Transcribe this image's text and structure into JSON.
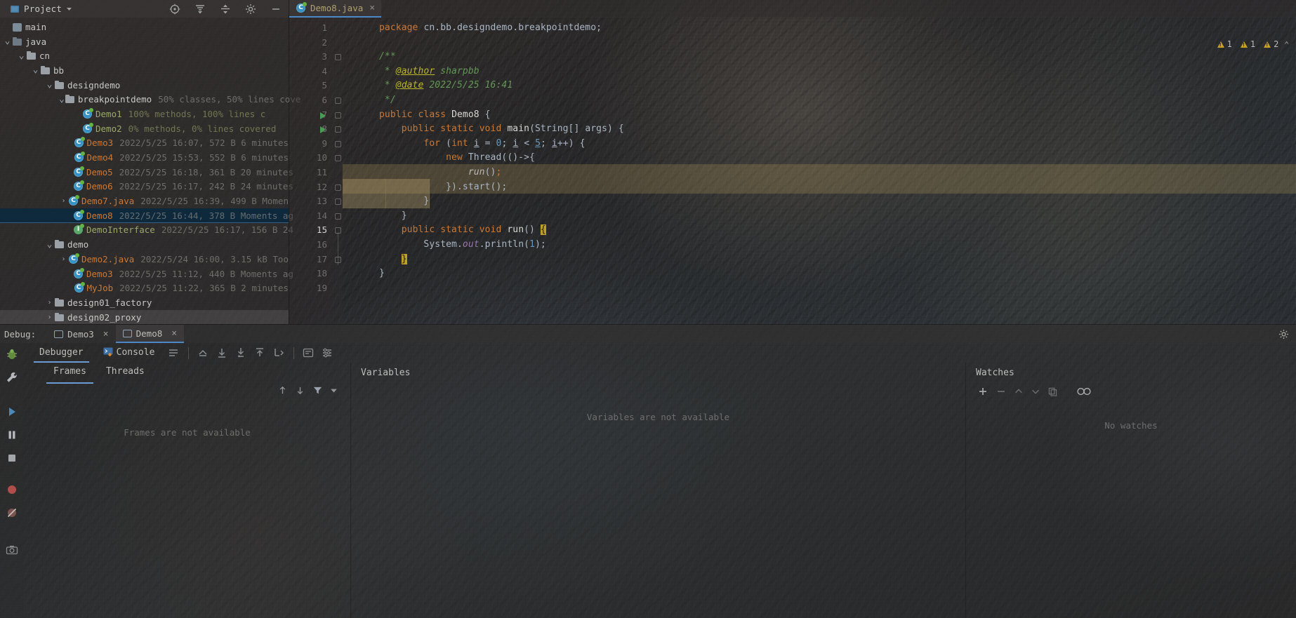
{
  "project": {
    "header_title": "Project",
    "icons": [
      "project-view-icon",
      "chevron-down-icon",
      "locate-icon",
      "expand-all-icon",
      "collapse-all-icon",
      "settings-gear-icon",
      "minimize-icon"
    ],
    "tree": [
      {
        "indent": 0,
        "arrow": "",
        "icon": "module-icon",
        "name": "main",
        "name_class": "n-white",
        "meta": ""
      },
      {
        "indent": 0,
        "arrow": "v",
        "icon": "folder-src",
        "name": "java",
        "name_class": "n-white",
        "meta": ""
      },
      {
        "indent": 1,
        "arrow": "v",
        "icon": "folder",
        "name": "cn",
        "name_class": "n-white",
        "meta": ""
      },
      {
        "indent": 2,
        "arrow": "v",
        "icon": "folder",
        "name": "bb",
        "name_class": "n-white",
        "meta": ""
      },
      {
        "indent": 3,
        "arrow": "v",
        "icon": "folder",
        "name": "designdemo",
        "name_class": "n-white",
        "meta": ""
      },
      {
        "indent": 4,
        "arrow": "v",
        "icon": "folder",
        "name": "breakpointdemo",
        "name_class": "n-white",
        "meta": "50% classes, 50% lines cove"
      },
      {
        "indent": 5,
        "arrow": "",
        "icon": "class",
        "name": "Demo1",
        "name_class": "n-green-t",
        "meta": "100% methods, 100% lines c",
        "meta_class": "meta-green"
      },
      {
        "indent": 5,
        "arrow": "",
        "icon": "class",
        "name": "Demo2",
        "name_class": "n-green-t",
        "meta": "0% methods, 0% lines covered",
        "meta_class": "meta-green"
      },
      {
        "indent": 5,
        "arrow": "",
        "icon": "class",
        "name": "Demo3",
        "name_class": "n-orange",
        "meta": "2022/5/25 16:07, 572 B 6 minutes"
      },
      {
        "indent": 5,
        "arrow": "",
        "icon": "class",
        "name": "Demo4",
        "name_class": "n-orange",
        "meta": "2022/5/25 15:53, 552 B 6 minutes"
      },
      {
        "indent": 5,
        "arrow": "",
        "icon": "class",
        "name": "Demo5",
        "name_class": "n-orange",
        "meta": "2022/5/25 16:18, 361 B 20 minutes"
      },
      {
        "indent": 5,
        "arrow": "",
        "icon": "class",
        "name": "Demo6",
        "name_class": "n-orange",
        "meta": "2022/5/25 16:17, 242 B 24 minutes"
      },
      {
        "indent": 4,
        "arrow": ">",
        "icon": "class",
        "name": "Demo7.java",
        "name_class": "n-orange",
        "meta": "2022/5/25 16:39, 499 B Momen"
      },
      {
        "indent": 5,
        "arrow": "",
        "icon": "class",
        "name": "Demo8",
        "name_class": "n-orange",
        "meta": "2022/5/25 16:44, 378 B Moments ag",
        "selected": true
      },
      {
        "indent": 5,
        "arrow": "",
        "icon": "interface",
        "name": "DemoInterface",
        "name_class": "n-green-t",
        "meta": "2022/5/25 16:17, 156 B 24"
      },
      {
        "indent": 3,
        "arrow": "v",
        "icon": "folder",
        "name": "demo",
        "name_class": "n-white",
        "meta": ""
      },
      {
        "indent": 4,
        "arrow": ">",
        "icon": "class",
        "name": "Demo2.java",
        "name_class": "n-orange",
        "meta": "2022/5/24 16:00, 3.15 kB Too"
      },
      {
        "indent": 5,
        "arrow": "",
        "icon": "class",
        "name": "Demo3",
        "name_class": "n-orange",
        "meta": "2022/5/25 11:12, 440 B Moments ag"
      },
      {
        "indent": 5,
        "arrow": "",
        "icon": "class",
        "name": "MyJob",
        "name_class": "n-orange",
        "meta": "2022/5/25 11:22, 365 B 2 minutes"
      },
      {
        "indent": 3,
        "arrow": ">",
        "icon": "folder",
        "name": "design01_factory",
        "name_class": "n-white",
        "meta": ""
      },
      {
        "indent": 3,
        "arrow": ">",
        "icon": "folder",
        "name": "design02_proxy",
        "name_class": "n-white",
        "meta": "",
        "hl_light": true
      }
    ]
  },
  "editor": {
    "tab": {
      "label": "Demo8.java",
      "icon": "java-class-icon",
      "close": "×"
    },
    "inspection": {
      "warnings_1": "1",
      "warnings_2": "1",
      "warnings_3": "2",
      "chevron": "⌃"
    },
    "line_numbers": [
      "1",
      "2",
      "3",
      "4",
      "5",
      "6",
      "7",
      "8",
      "9",
      "10",
      "11",
      "12",
      "13",
      "14",
      "15",
      "16",
      "17",
      "18",
      "19"
    ],
    "current_line": "15",
    "code_lines": [
      {
        "n": 1,
        "html": "<span class=\"kw\">package</span> <span class=\"plain\">cn.bb.designdemo.breakpointdemo</span><span class=\"plain\">;</span>"
      },
      {
        "n": 2,
        "html": ""
      },
      {
        "n": 3,
        "html": "<span class=\"cmt\">/**</span>"
      },
      {
        "n": 4,
        "html": "<span class=\"cmt\"> * </span><span class=\"tag\">@author</span><span class=\"cmt\"> sharpbb</span>"
      },
      {
        "n": 5,
        "html": "<span class=\"cmt\"> * </span><span class=\"tag\">@date</span><span class=\"cmt\"> 2022/5/25 16:41</span>"
      },
      {
        "n": 6,
        "html": "<span class=\"cmt\"> */</span>"
      },
      {
        "n": 7,
        "html": "<span class=\"kw\">public class</span> <span class=\"white\">Demo8</span> <span class=\"plain\">{</span>"
      },
      {
        "n": 8,
        "html": "    <span class=\"kw\">public static void</span> <span class=\"white\">main</span><span class=\"plain\">(String[] args) {</span>"
      },
      {
        "n": 9,
        "html": "        <span class=\"kw\">for</span> <span class=\"plain\">(</span><span class=\"kw\">int</span> <span class=\"var\">i</span> <span class=\"plain\">=</span> <span class=\"num\">0</span><span class=\"plain\">;</span> <span class=\"var\">i</span> <span class=\"plain\">&lt;</span> <span class=\"num\"><u>5</u></span><span class=\"plain\">;</span> <span class=\"var\">i</span><span class=\"plain\">++) {</span>"
      },
      {
        "n": 10,
        "html": "            <span class=\"kw\">new</span> <span class=\"plain\">Thread(()-&gt;{</span>"
      },
      {
        "n": 11,
        "html": "                <span class=\"cmt\" style=\"color:#b9b9b5\"><i>run</i></span><span class=\"plain\">()</span><span class=\"kw\">;</span>"
      },
      {
        "n": 12,
        "html": "            <span class=\"plain\">}).start();</span>"
      },
      {
        "n": 13,
        "html": "        <span class=\"plain\">}</span>"
      },
      {
        "n": 14,
        "html": "    <span class=\"plain\">}</span>"
      },
      {
        "n": 15,
        "html": "    <span class=\"kw\">public static void</span> <span class=\"white\">run</span><span class=\"plain\">()</span> <span class=\"err-brace\">{</span>"
      },
      {
        "n": 16,
        "html": "        <span class=\"plain\">System.</span><span class=\"field\">out</span><span class=\"plain\">.println(</span><span class=\"num\">1</span><span class=\"plain\">);</span>"
      },
      {
        "n": 17,
        "html": "    <span class=\"err-brace\">}</span>"
      },
      {
        "n": 18,
        "html": "<span class=\"plain\">}</span>"
      },
      {
        "n": 19,
        "html": ""
      }
    ],
    "breakpoint_run_lines": [
      7,
      8
    ]
  },
  "debug": {
    "label": "Debug:",
    "sessions": [
      {
        "name": "Demo3",
        "active": false
      },
      {
        "name": "Demo8",
        "active": true
      }
    ],
    "settings_icon": "settings-gear-icon",
    "sidebar_icons": [
      "bug-icon",
      "wrench-icon",
      "resume-icon",
      "pause-icon",
      "stop-icon",
      "camera-icon",
      "mute-breakpoints-icon",
      "screenshot-icon"
    ],
    "tabs": [
      {
        "label": "Debugger",
        "active": true,
        "icon": ""
      },
      {
        "label": "Console",
        "active": false,
        "icon": "console-icon"
      }
    ],
    "toolbar_icons": [
      "layout-icon",
      "show-execution-point-icon",
      "step-over-icon",
      "step-into-icon",
      "force-step-into-icon",
      "step-out-icon",
      "run-to-cursor-icon",
      "evaluate-icon",
      "settings-icon"
    ],
    "frames": {
      "tabs": [
        {
          "label": "Frames",
          "active": true
        },
        {
          "label": "Threads",
          "active": false
        }
      ],
      "toolbar_icons": [
        "arrow-up-icon",
        "arrow-down-icon",
        "filter-icon",
        "chevron-down-icon"
      ],
      "empty_message": "Frames are not available"
    },
    "variables": {
      "title": "Variables",
      "empty_message": "Variables are not available"
    },
    "watches": {
      "title": "Watches",
      "toolbar_icons": [
        "plus-icon",
        "minus-icon",
        "up-icon",
        "down-icon",
        "copy-icon",
        "inspect-icon"
      ],
      "empty_message": "No watches"
    }
  }
}
